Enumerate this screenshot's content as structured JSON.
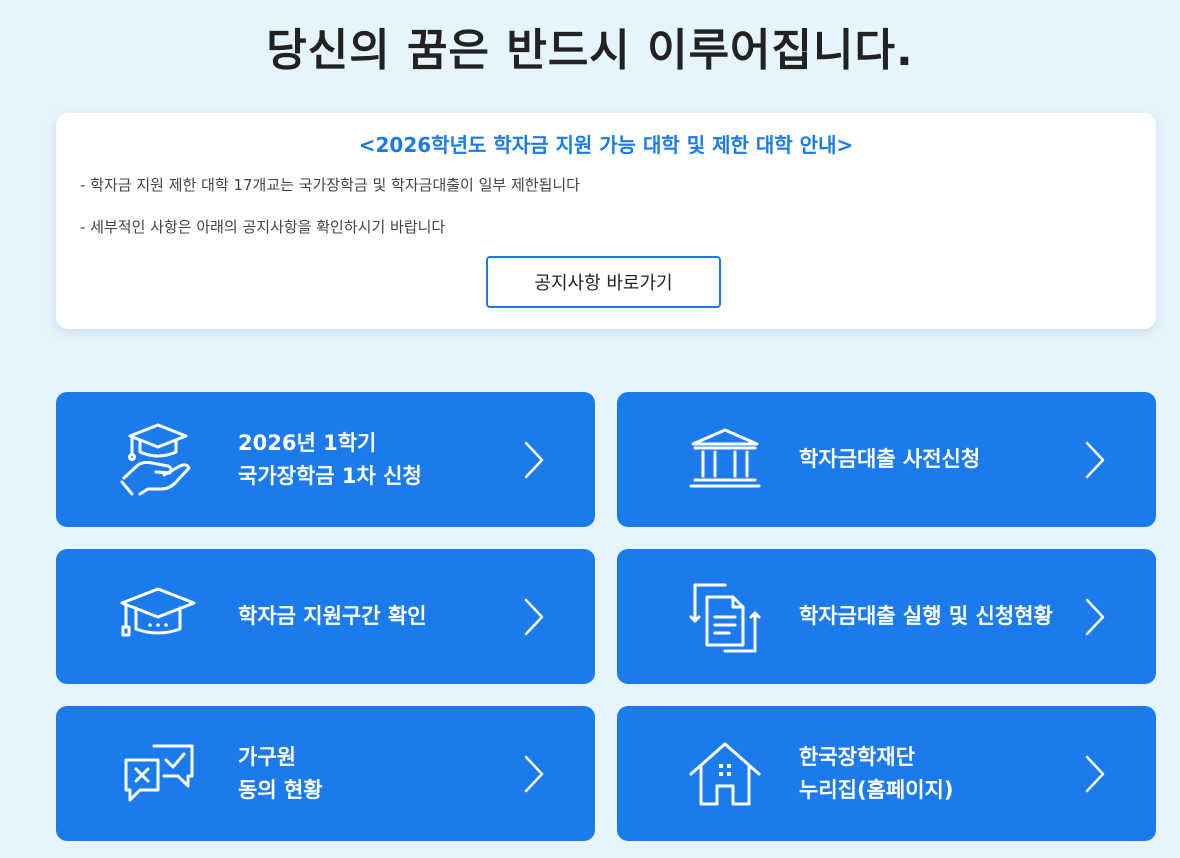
{
  "headline": "당신의 꿈은 반드시 이루어집니다.",
  "notice": {
    "title": "<2026학년도 학자금 지원 가능 대학 및 제한 대학 안내>",
    "lines": [
      "- 학자금 지원 제한 대학 17개교는 국가장학금 및 학자금대출이 일부 제한됩니다",
      "- 세부적인 사항은 아래의 공지사항을 확인하시기 바랍니다"
    ],
    "button_label": "공지사항 바로가기"
  },
  "cards": [
    {
      "icon": "graduation-cap-hand-icon",
      "line1": "2026년 1학기",
      "line2": "국가장학금 1차 신청"
    },
    {
      "icon": "bank-building-icon",
      "line1": "학자금대출 사전신청",
      "line2": ""
    },
    {
      "icon": "graduation-cap-icon",
      "line1": "학자금 지원구간 확인",
      "line2": ""
    },
    {
      "icon": "document-refresh-icon",
      "line1": "학자금대출 실행 및 신청현황",
      "line2": ""
    },
    {
      "icon": "chat-check-icon",
      "line1": "가구원",
      "line2": "동의 현황"
    },
    {
      "icon": "house-icon",
      "line1": "한국장학재단",
      "line2": "누리집(홈페이지)"
    }
  ],
  "colors": {
    "background": "#e6f5fd",
    "card_blue": "#1b7bec",
    "accent_blue": "#1a7be8"
  }
}
